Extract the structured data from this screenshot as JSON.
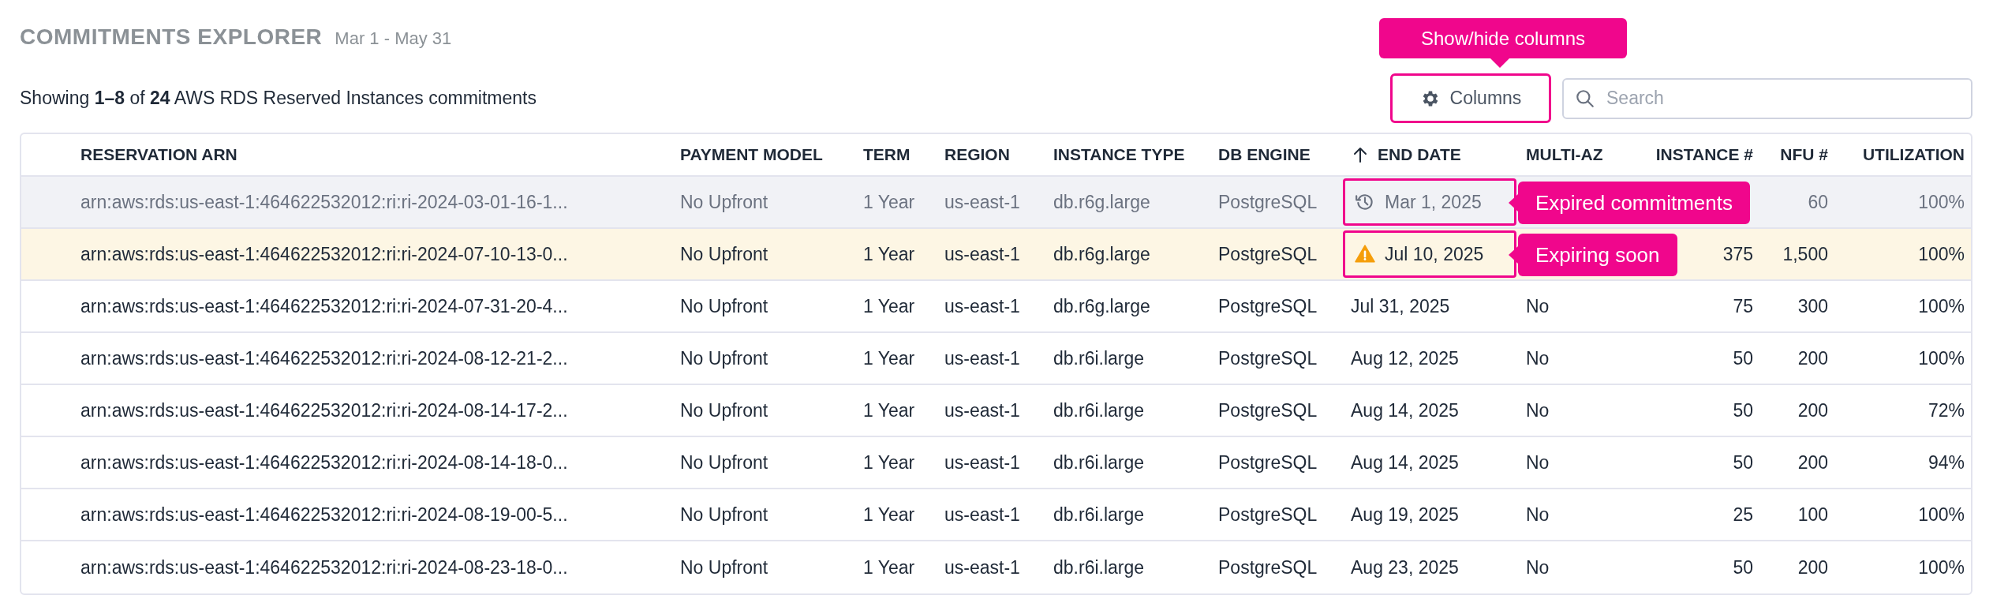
{
  "header": {
    "title": "COMMITMENTS EXPLORER",
    "date_range": "Mar 1 - May 31"
  },
  "summary": "Showing **1–8** of **24** AWS RDS Reserved Instances commitments",
  "columns_button": {
    "label": "Columns",
    "callout": "Show/hide columns"
  },
  "search": {
    "placeholder": "Search"
  },
  "table": {
    "columns": [
      {
        "label": "RESERVATION ARN",
        "sorted": false
      },
      {
        "label": "PAYMENT MODEL",
        "sorted": false
      },
      {
        "label": "TERM",
        "sorted": false
      },
      {
        "label": "REGION",
        "sorted": false
      },
      {
        "label": "INSTANCE TYPE",
        "sorted": false
      },
      {
        "label": "DB ENGINE",
        "sorted": false
      },
      {
        "label": "END DATE",
        "sorted": true
      },
      {
        "label": "MULTI-AZ",
        "sorted": false
      },
      {
        "label": "INSTANCE #",
        "sorted": false
      },
      {
        "label": "NFU #",
        "sorted": false
      },
      {
        "label": "UTILIZATION",
        "sorted": false
      }
    ],
    "rows": [
      {
        "kind": "expired",
        "callout": "Expired commitments",
        "arn": "arn:aws:rds:us-east-1:464622532012:ri:ri-2024-03-01-16-1...",
        "payment_model": "No Upfront",
        "term": "1 Year",
        "region": "us-east-1",
        "instance_type": "db.r6g.large",
        "db_engine": "PostgreSQL",
        "end_date": "Mar 1, 2025",
        "nfu_count": "60",
        "utilization": "100%"
      },
      {
        "kind": "expiring",
        "callout": "Expiring soon",
        "arn": "arn:aws:rds:us-east-1:464622532012:ri:ri-2024-07-10-13-0...",
        "payment_model": "No Upfront",
        "term": "1 Year",
        "region": "us-east-1",
        "instance_type": "db.r6g.large",
        "db_engine": "PostgreSQL",
        "end_date": "Jul 10, 2025",
        "instance_count": "375",
        "nfu_count": "1,500",
        "utilization": "100%"
      },
      {
        "kind": "active",
        "arn": "arn:aws:rds:us-east-1:464622532012:ri:ri-2024-07-31-20-4...",
        "payment_model": "No Upfront",
        "term": "1 Year",
        "region": "us-east-1",
        "instance_type": "db.r6g.large",
        "db_engine": "PostgreSQL",
        "end_date": "Jul 31, 2025",
        "multi_az": "No",
        "instance_count": "75",
        "nfu_count": "300",
        "utilization": "100%"
      },
      {
        "kind": "active",
        "arn": "arn:aws:rds:us-east-1:464622532012:ri:ri-2024-08-12-21-2...",
        "payment_model": "No Upfront",
        "term": "1 Year",
        "region": "us-east-1",
        "instance_type": "db.r6i.large",
        "db_engine": "PostgreSQL",
        "end_date": "Aug 12, 2025",
        "multi_az": "No",
        "instance_count": "50",
        "nfu_count": "200",
        "utilization": "100%"
      },
      {
        "kind": "active",
        "arn": "arn:aws:rds:us-east-1:464622532012:ri:ri-2024-08-14-17-2...",
        "payment_model": "No Upfront",
        "term": "1 Year",
        "region": "us-east-1",
        "instance_type": "db.r6i.large",
        "db_engine": "PostgreSQL",
        "end_date": "Aug 14, 2025",
        "multi_az": "No",
        "instance_count": "50",
        "nfu_count": "200",
        "utilization": "72%"
      },
      {
        "kind": "active",
        "arn": "arn:aws:rds:us-east-1:464622532012:ri:ri-2024-08-14-18-0...",
        "payment_model": "No Upfront",
        "term": "1 Year",
        "region": "us-east-1",
        "instance_type": "db.r6i.large",
        "db_engine": "PostgreSQL",
        "end_date": "Aug 14, 2025",
        "multi_az": "No",
        "instance_count": "50",
        "nfu_count": "200",
        "utilization": "94%"
      },
      {
        "kind": "active",
        "arn": "arn:aws:rds:us-east-1:464622532012:ri:ri-2024-08-19-00-5...",
        "payment_model": "No Upfront",
        "term": "1 Year",
        "region": "us-east-1",
        "instance_type": "db.r6i.large",
        "db_engine": "PostgreSQL",
        "end_date": "Aug 19, 2025",
        "multi_az": "No",
        "instance_count": "25",
        "nfu_count": "100",
        "utilization": "100%"
      },
      {
        "kind": "active",
        "arn": "arn:aws:rds:us-east-1:464622532012:ri:ri-2024-08-23-18-0...",
        "payment_model": "No Upfront",
        "term": "1 Year",
        "region": "us-east-1",
        "instance_type": "db.r6i.large",
        "db_engine": "PostgreSQL",
        "end_date": "Aug 23, 2025",
        "multi_az": "No",
        "instance_count": "50",
        "nfu_count": "200",
        "utilization": "100%"
      }
    ]
  }
}
